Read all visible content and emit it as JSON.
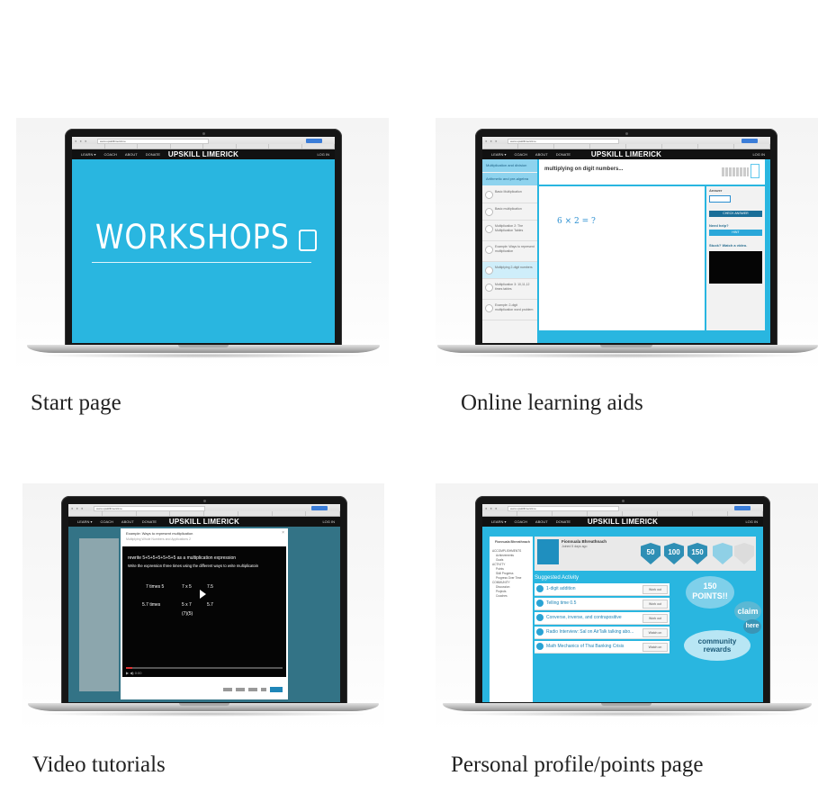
{
  "captions": {
    "start": "Start page",
    "learning": "Online learning aids",
    "video": "Video tutorials",
    "profile": "Personal profile/points page"
  },
  "site": {
    "brand": "UPSKILL LIMERICK",
    "nav": [
      "LEARN ▾",
      "COACH",
      "ABOUT",
      "DONATE"
    ],
    "login": "LOG IN",
    "url": "www.upskilllimerick.ie"
  },
  "screen1": {
    "title": "WORKSHOPS",
    "icon": "scroll-icon"
  },
  "screen2": {
    "sidebar_heads": [
      "Multiplication and division",
      "Arithmetic and pre-algebra"
    ],
    "sidebar_items": [
      "Basic Multiplication",
      "Basic multiplication",
      "Multiplication 2: The Multiplication Tables",
      "Example: Ways to represent multiplication",
      "Multiplying 2-digit numbers",
      "Multiplication 3: 10,11,12 times tables",
      "Example: 2-digit multiplication word problem"
    ],
    "title": "multiplying on digit numbers...",
    "problem": "6 × 2 = ?",
    "answer_label": "Answer",
    "check_button": "CHECK ANSWER",
    "help_label": "Need help?",
    "hint_button": "HINT",
    "stuck_label": "Stuck? Watch a video."
  },
  "screen3": {
    "breadcrumb": "Example: Ways to represent multiplication",
    "video_title": "Multiplying Whole Numbers and Applications 2",
    "line1": "rewrite 5+5+5+5+5+5+5 as a multiplication expression",
    "line2": "Write the expression three times using the different ways to write multiplicatoin",
    "cells": [
      "7 times 5",
      "7 x 5",
      "7.5",
      "5.7 times",
      "5 x 7",
      "5.7",
      "(7)(5)"
    ]
  },
  "screen4": {
    "user": "Fionnuala Bhreathnach",
    "joined": "Joined 5 days ago",
    "badges": [
      "50",
      "100",
      "150"
    ],
    "section": "Suggested Activity",
    "activities": [
      {
        "title": "1-digit addition",
        "action": "Work out"
      },
      {
        "title": "Telling time 0.5",
        "action": "Work out"
      },
      {
        "title": "Converse, inverse, and contrapositive",
        "action": "Work out"
      },
      {
        "title": "Radio Interview: Sal on AirTalk talking abo...",
        "action": "Watch on"
      },
      {
        "title": "Math Mechanics of Thai Banking Crisis",
        "action": "Watch on"
      }
    ],
    "bubble_points": "150 POINTS!!",
    "bubble_claim": "claim",
    "bubble_here": "here",
    "bubble_rewards": "community rewards",
    "menu": [
      "ACCOMPLISHMENTS",
      "Achievements",
      "Goals",
      "ACTIVITY",
      "Points",
      "Skill Progress",
      "Progress Over Time",
      "COMMUNITY",
      "Discussion",
      "Projects",
      "Coaches"
    ]
  },
  "colors": {
    "accent": "#29b6e0",
    "nav": "#111111"
  }
}
